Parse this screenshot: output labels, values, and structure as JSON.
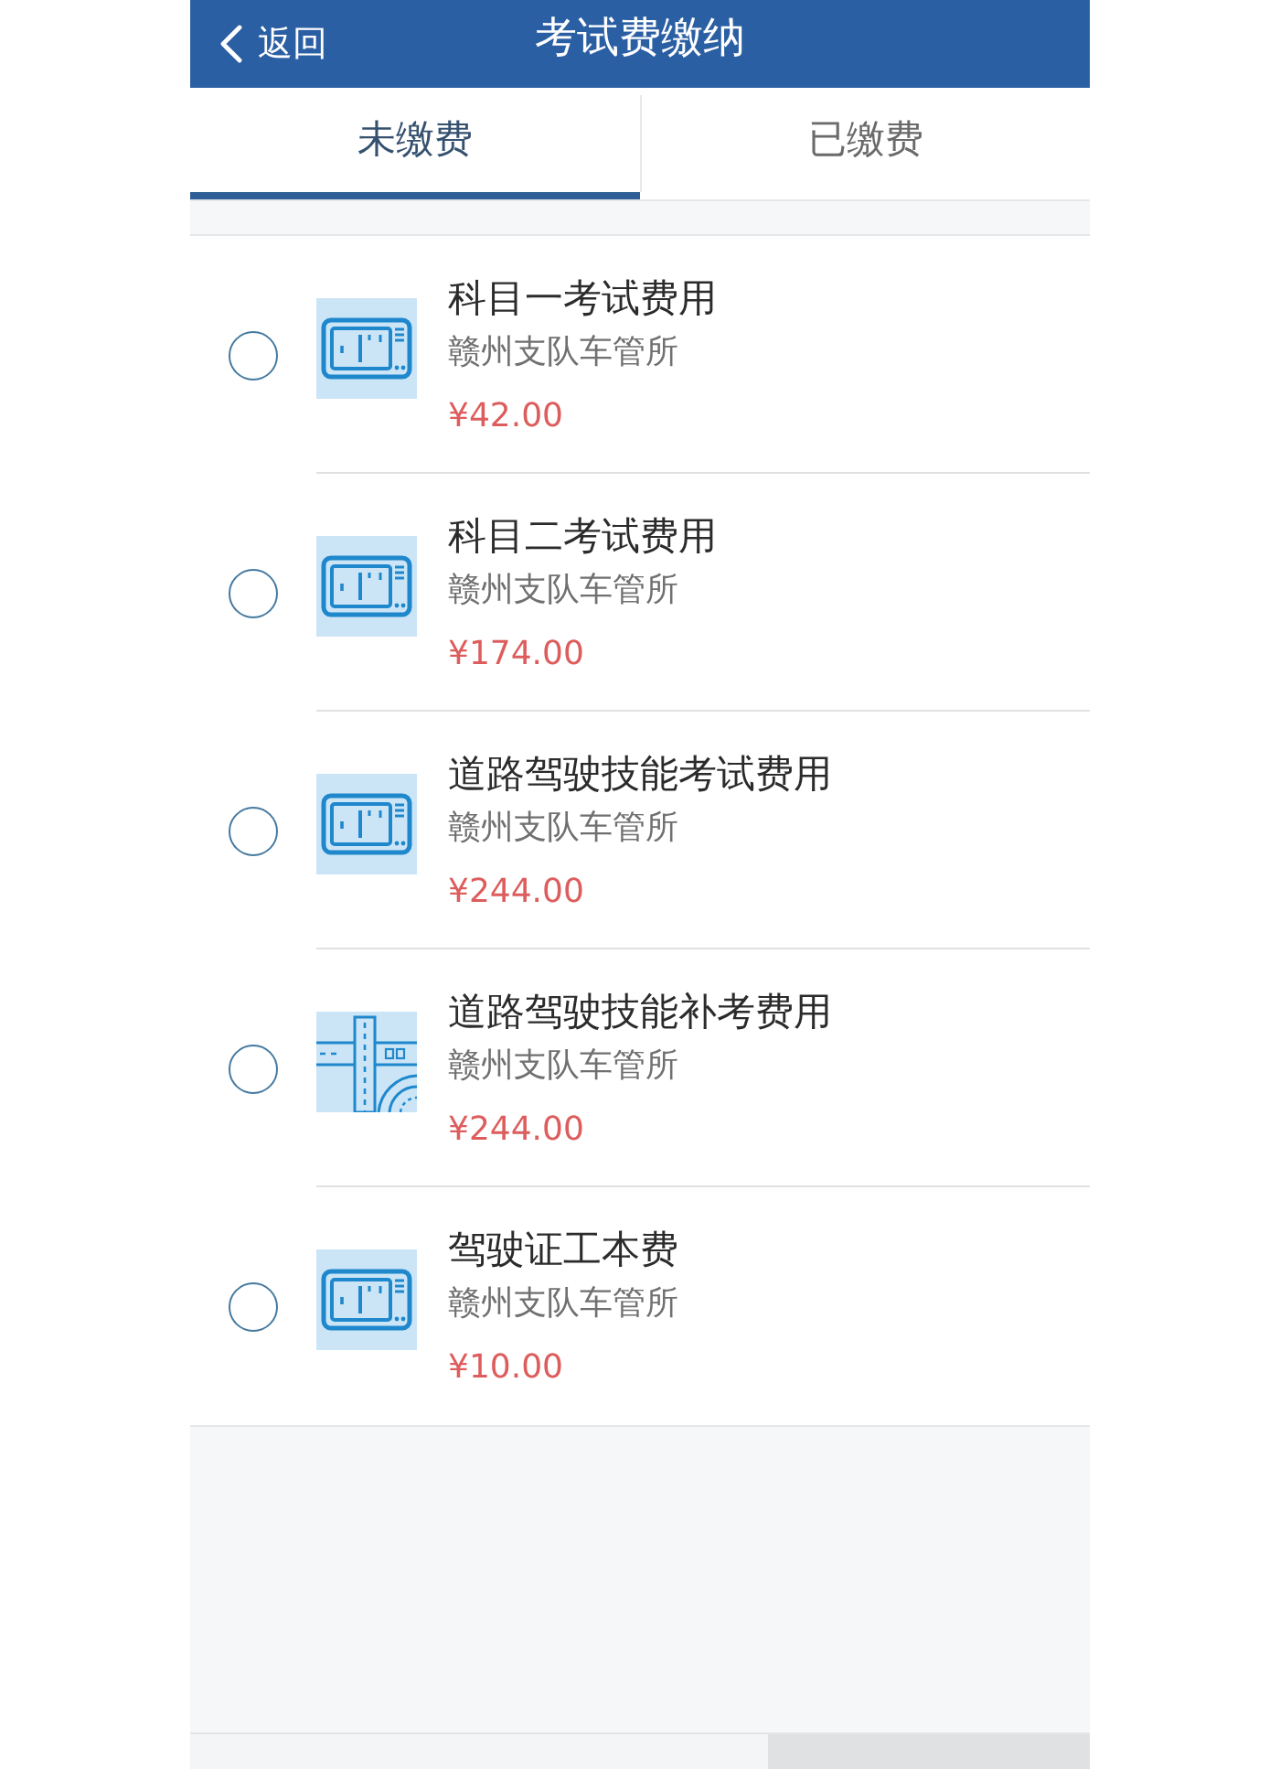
{
  "header": {
    "back": {
      "label": "返回"
    },
    "title": "考试费缴纳"
  },
  "tabs": [
    {
      "label": "未缴费",
      "selected": true
    },
    {
      "label": "已缴费",
      "selected": false
    }
  ],
  "fees": [
    {
      "kind": "panel",
      "title": "科目一考试费用",
      "office": "赣州支队车管所",
      "price": "¥42.00",
      "selected": false
    },
    {
      "kind": "panel",
      "title": "科目二考试费用",
      "office": "赣州支队车管所",
      "price": "¥174.00",
      "selected": false
    },
    {
      "kind": "panel",
      "title": "道路驾驶技能考试费用",
      "office": "赣州支队车管所",
      "price": "¥244.00",
      "selected": false
    },
    {
      "kind": "road",
      "title": "道路驾驶技能补考费用",
      "office": "赣州支队车管所",
      "price": "¥244.00",
      "selected": false
    },
    {
      "kind": "panel",
      "title": "驾驶证工本费",
      "office": "赣州支队车管所",
      "price": "¥10.00",
      "selected": false
    }
  ]
}
